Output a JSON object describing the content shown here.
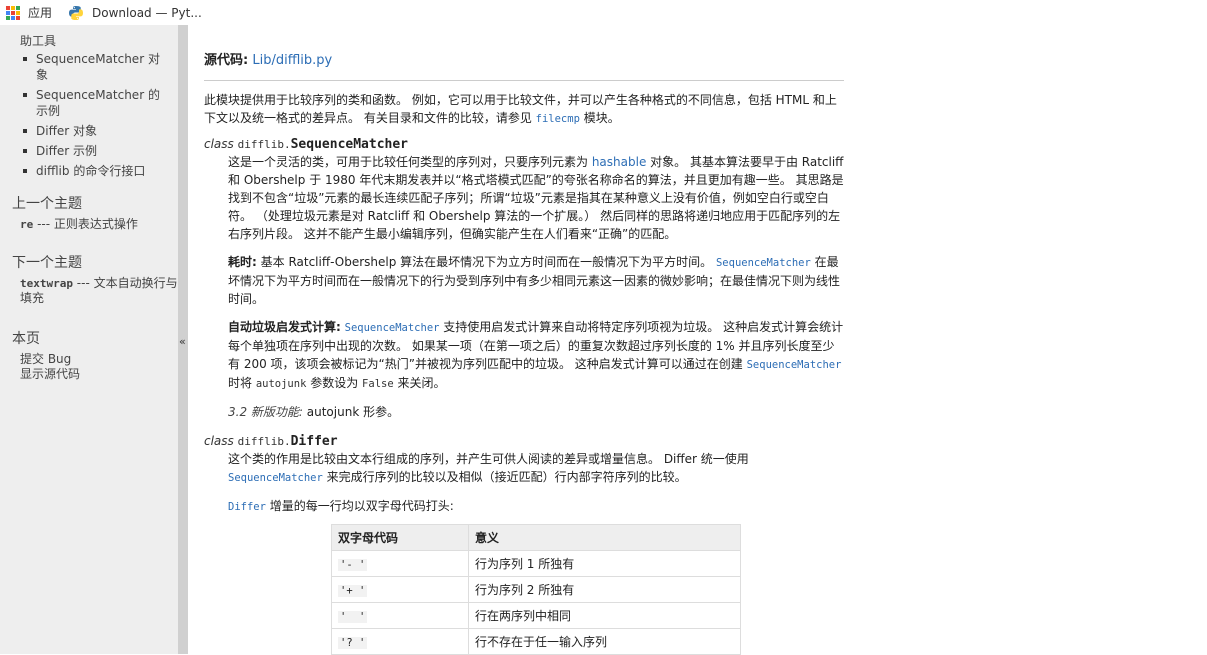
{
  "bookmarks": {
    "apps_label": "应用",
    "tab_label": "Download — Pyt...",
    "grid_colors": [
      "#ea4335",
      "#fbbc05",
      "#34a853",
      "#4285f4",
      "#ea4335",
      "#fbbc05",
      "#34a853",
      "#4285f4",
      "#ea4335"
    ]
  },
  "sidebar": {
    "cut_item": "助工具",
    "items": [
      "SequenceMatcher 对象",
      "SequenceMatcher 的示例",
      "Differ 对象",
      "Differ 示例",
      "difflib 的命令行接口"
    ],
    "prev_heading": "上一个主题",
    "prev_code": "re",
    "prev_text": " --- 正则表达式操作",
    "next_heading": "下一个主题",
    "next_code": "textwrap",
    "next_text": " --- 文本自动换行与填充",
    "this_heading": "本页",
    "report_bug": "提交 Bug",
    "show_source": "显示源代码",
    "collapse_glyph": "«"
  },
  "main": {
    "source_label": "源代码:",
    "source_link": "Lib/difflib.py",
    "intro_1": "此模块提供用于比较序列的类和函数。 例如，它可以用于比较文件，并可以产生各种格式的不同信息，包括 HTML 和上下文以及统一格式的差异点。 有关目录和文件的比较，请参见 ",
    "intro_code": "filecmp",
    "intro_2": " 模块。",
    "sm_class_kw": "class",
    "sm_prefix": "difflib.",
    "sm_name": "SequenceMatcher",
    "sm_p1_a": "这是一个灵活的类，可用于比较任何类型的序列对，只要序列元素为 ",
    "sm_p1_link": "hashable",
    "sm_p1_b": " 对象。 其基本算法要早于由 Ratcliff 和 Obershelp 于 1980 年代末期发表并以“格式塔模式匹配”的夸张名称命名的算法，并且更加有趣一些。 其思路是找到不包含“垃圾”元素的最长连续匹配子序列；所谓“垃圾”元素是指其在某种意义上没有价值，例如空白行或空白符。 （处理垃圾元素是对 Ratcliff 和 Obershelp 算法的一个扩展。） 然后同样的思路将递归地应用于匹配序列的左右序列片段。 这并不能产生最小编辑序列，但确实能产生在人们看来“正确”的匹配。",
    "sm_p2_bold": "耗时:",
    "sm_p2_a": " 基本 Ratcliff-Obershelp 算法在最坏情况下为立方时间而在一般情况下为平方时间。 ",
    "sm_p2_code": "SequenceMatcher",
    "sm_p2_b": " 在最坏情况下为平方时间而在一般情况下的行为受到序列中有多少相同元素这一因素的微妙影响；在最佳情况下则为线性时间。",
    "sm_p3_bold": "自动垃圾启发式计算:",
    "sm_p3_code1": "SequenceMatcher",
    "sm_p3_a": " 支持使用启发式计算来自动将特定序列项视为垃圾。 这种启发式计算会统计每个单独项在序列中出现的次数。 如果某一项（在第一项之后）的重复次数超过序列长度的 1% 并且序列长度至少有 200 项，该项会被标记为“热门”并被视为序列匹配中的垃圾。 这种启发式计算可以通过在创建 ",
    "sm_p3_code2": "SequenceMatcher",
    "sm_p3_b": " 时将 ",
    "sm_p3_code3": "autojunk",
    "sm_p3_c": " 参数设为 ",
    "sm_p3_code4": "False",
    "sm_p3_d": " 来关闭。",
    "sm_version_italic": "3.2 新版功能:",
    "sm_version_text": " autojunk 形参。",
    "df_class_kw": "class",
    "df_prefix": "difflib.",
    "df_name": "Differ",
    "df_p1_a": "这个类的作用是比较由文本行组成的序列，并产生可供人阅读的差异或增量信息。 Differ 统一使用 ",
    "df_p1_code": "SequenceMatcher",
    "df_p1_b": " 来完成行序列的比较以及相似（接近匹配）行内部字符序列的比较。",
    "df_p2_code": "Differ",
    "df_p2_text": " 增量的每一行均以双字母代码打头:",
    "table": {
      "headers": [
        "双字母代码",
        "意义"
      ],
      "rows": [
        {
          "code": "'- '",
          "meaning": "行为序列 1 所独有"
        },
        {
          "code": "'+ '",
          "meaning": "行为序列 2 所独有"
        },
        {
          "code": "'  '",
          "meaning": "行在两序列中相同"
        },
        {
          "code": "'? '",
          "meaning": "行不存在于任一输入序列"
        }
      ]
    }
  }
}
